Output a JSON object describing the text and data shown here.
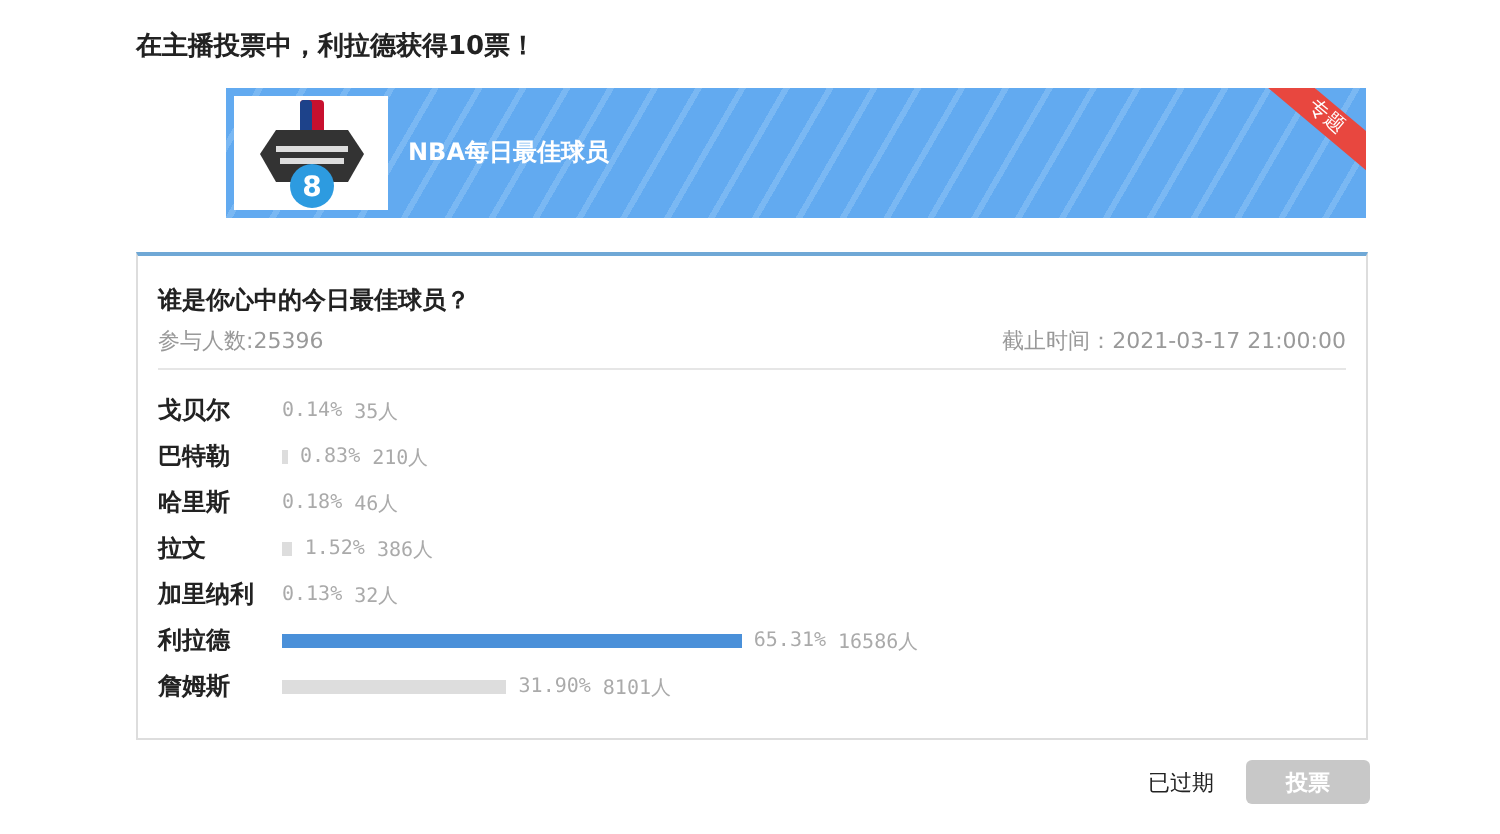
{
  "headline": "在主播投票中，利拉德获得10票！",
  "banner": {
    "title": "NBA每日最佳球员",
    "logo_number": "8",
    "ribbon": "专题"
  },
  "poll": {
    "question": "谁是你心中的今日最佳球员？",
    "participants": "参与人数:25396",
    "deadline": "截止时间：2021-03-17 21:00:00",
    "options": [
      {
        "name": "戈贝尔",
        "percent": "0.14%",
        "votes": "35人"
      },
      {
        "name": "巴特勒",
        "percent": "0.83%",
        "votes": "210人",
        "highlighted": false
      },
      {
        "name": "哈里斯",
        "percent": "0.18%",
        "votes": "46人"
      },
      {
        "name": "拉文",
        "percent": "1.52%",
        "votes": "386人",
        "highlighted": false
      },
      {
        "name": "加里纳利",
        "percent": "0.13%",
        "votes": "32人"
      },
      {
        "name": "利拉德",
        "percent": "65.31%",
        "votes": "16586人",
        "highlighted": true
      },
      {
        "name": "詹姆斯",
        "percent": "31.90%",
        "votes": "8101人",
        "highlighted": false
      }
    ]
  },
  "footer": {
    "status": "已过期",
    "vote_button": {
      "label": "投票",
      "disabled": true
    }
  }
}
